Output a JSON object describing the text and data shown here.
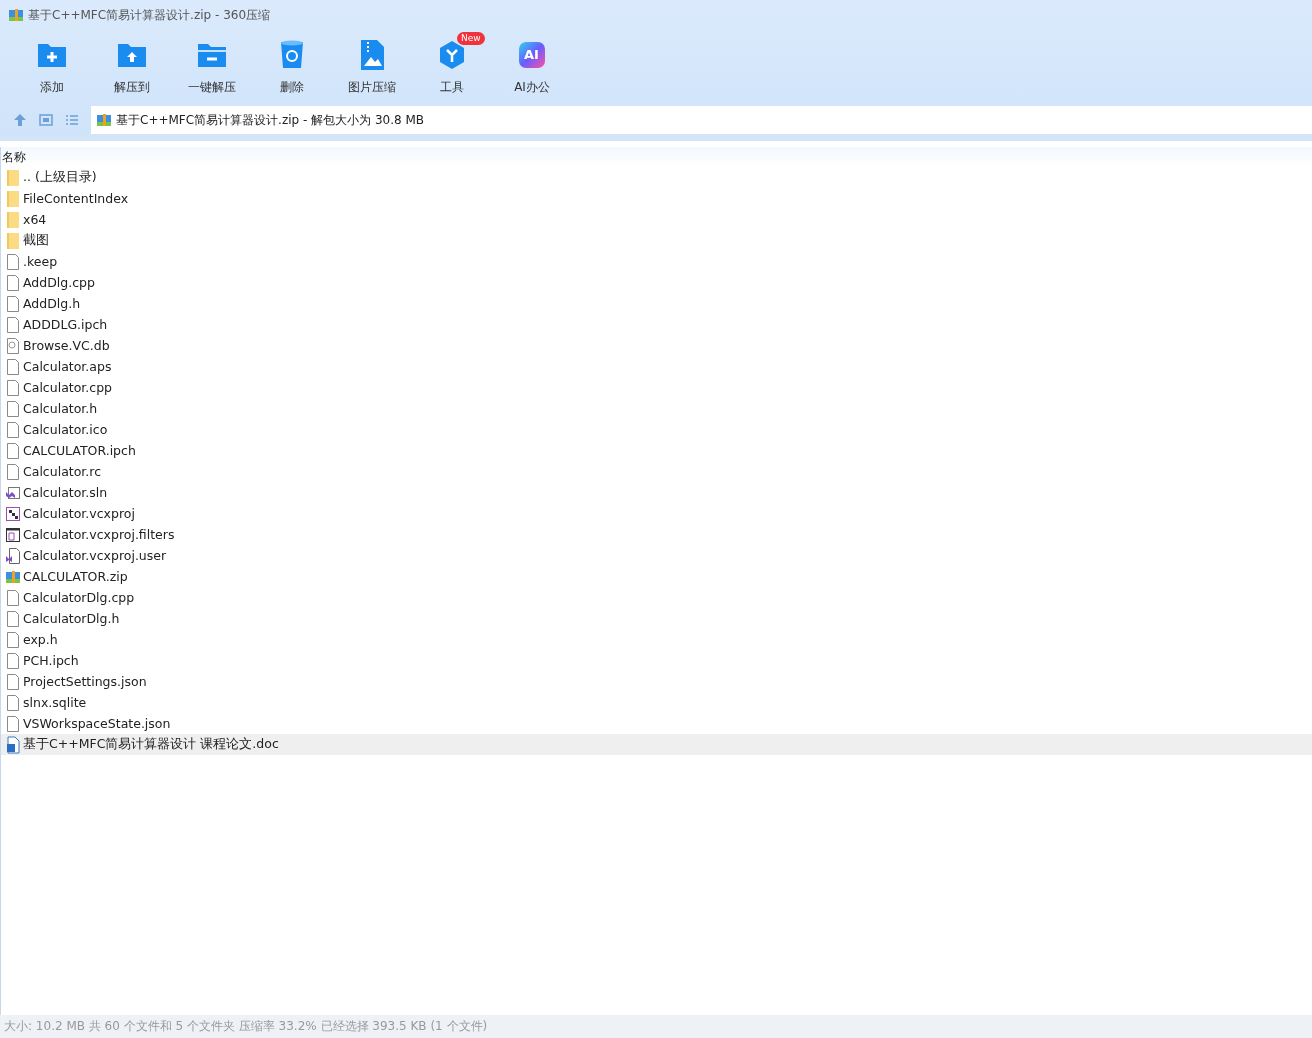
{
  "window": {
    "title": "基于C++MFC简易计算器设计.zip - 360压缩"
  },
  "toolbar": [
    {
      "kind": "add",
      "label": "添加"
    },
    {
      "kind": "extract",
      "label": "解压到"
    },
    {
      "kind": "oneclick",
      "label": "一键解压"
    },
    {
      "kind": "delete",
      "label": "删除"
    },
    {
      "kind": "image",
      "label": "图片压缩"
    },
    {
      "kind": "tools",
      "label": "工具",
      "badge": "New"
    },
    {
      "kind": "ai",
      "label": "AI办公",
      "icon_text": "AI"
    }
  ],
  "address": {
    "path": "基于C++MFC简易计算器设计.zip - 解包大小为 30.8 MB"
  },
  "table": {
    "columns": [
      "名称"
    ],
    "rows": [
      {
        "kind": "folder",
        "name": ".. (上级目录)",
        "selected": false
      },
      {
        "kind": "folder",
        "name": "FileContentIndex",
        "selected": false
      },
      {
        "kind": "folder",
        "name": "x64",
        "selected": false
      },
      {
        "kind": "folder",
        "name": "截图",
        "selected": false
      },
      {
        "kind": "file",
        "name": ".keep",
        "selected": false
      },
      {
        "kind": "file",
        "name": "AddDlg.cpp",
        "selected": false
      },
      {
        "kind": "file",
        "name": "AddDlg.h",
        "selected": false
      },
      {
        "kind": "file",
        "name": "ADDDLG.ipch",
        "selected": false
      },
      {
        "kind": "db",
        "name": "Browse.VC.db",
        "selected": false
      },
      {
        "kind": "file",
        "name": "Calculator.aps",
        "selected": false
      },
      {
        "kind": "file",
        "name": "Calculator.cpp",
        "selected": false
      },
      {
        "kind": "file",
        "name": "Calculator.h",
        "selected": false
      },
      {
        "kind": "file",
        "name": "Calculator.ico",
        "selected": false
      },
      {
        "kind": "file",
        "name": "CALCULATOR.ipch",
        "selected": false
      },
      {
        "kind": "file",
        "name": "Calculator.rc",
        "selected": false
      },
      {
        "kind": "sln",
        "name": "Calculator.sln",
        "selected": false
      },
      {
        "kind": "vcxproj",
        "name": "Calculator.vcxproj",
        "selected": false
      },
      {
        "kind": "filters",
        "name": "Calculator.vcxproj.filters",
        "selected": false
      },
      {
        "kind": "user",
        "name": "Calculator.vcxproj.user",
        "selected": false
      },
      {
        "kind": "zip",
        "name": "CALCULATOR.zip",
        "selected": false
      },
      {
        "kind": "file",
        "name": "CalculatorDlg.cpp",
        "selected": false
      },
      {
        "kind": "file",
        "name": "CalculatorDlg.h",
        "selected": false
      },
      {
        "kind": "file",
        "name": "exp.h",
        "selected": false
      },
      {
        "kind": "file",
        "name": "PCH.ipch",
        "selected": false
      },
      {
        "kind": "file",
        "name": "ProjectSettings.json",
        "selected": false
      },
      {
        "kind": "file",
        "name": "slnx.sqlite",
        "selected": false
      },
      {
        "kind": "file",
        "name": "VSWorkspaceState.json",
        "selected": false
      },
      {
        "kind": "doc",
        "name": "基于C++MFC简易计算器设计 课程论文.doc",
        "selected": true
      }
    ]
  },
  "status_bar": {
    "text": "大小: 10.2 MB 共 60 个文件和 5 个文件夹 压缩率 33.2% 已经选择 393.5 KB (1 个文件)"
  }
}
